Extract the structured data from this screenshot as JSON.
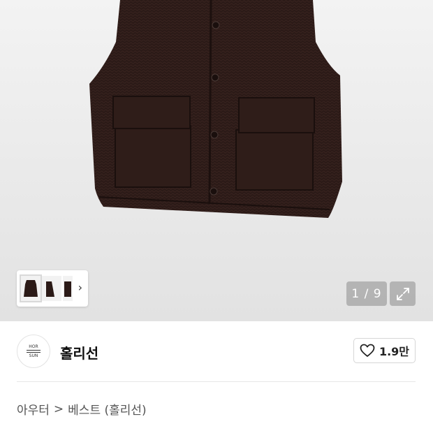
{
  "gallery": {
    "counter": "1 / 9",
    "thumb_next_icon": "chevron-right-icon",
    "expand_icon": "expand-icon",
    "product_color": "#2b1a17"
  },
  "brand": {
    "logo_text_top": "HOR",
    "logo_text_bottom": "SUN",
    "name": "홀리선",
    "like_icon": "heart-outline-icon",
    "like_count": "1.9만"
  },
  "breadcrumb": {
    "category": "아우터",
    "separator": ">",
    "subcategory": "베스트 (홀리선)"
  }
}
